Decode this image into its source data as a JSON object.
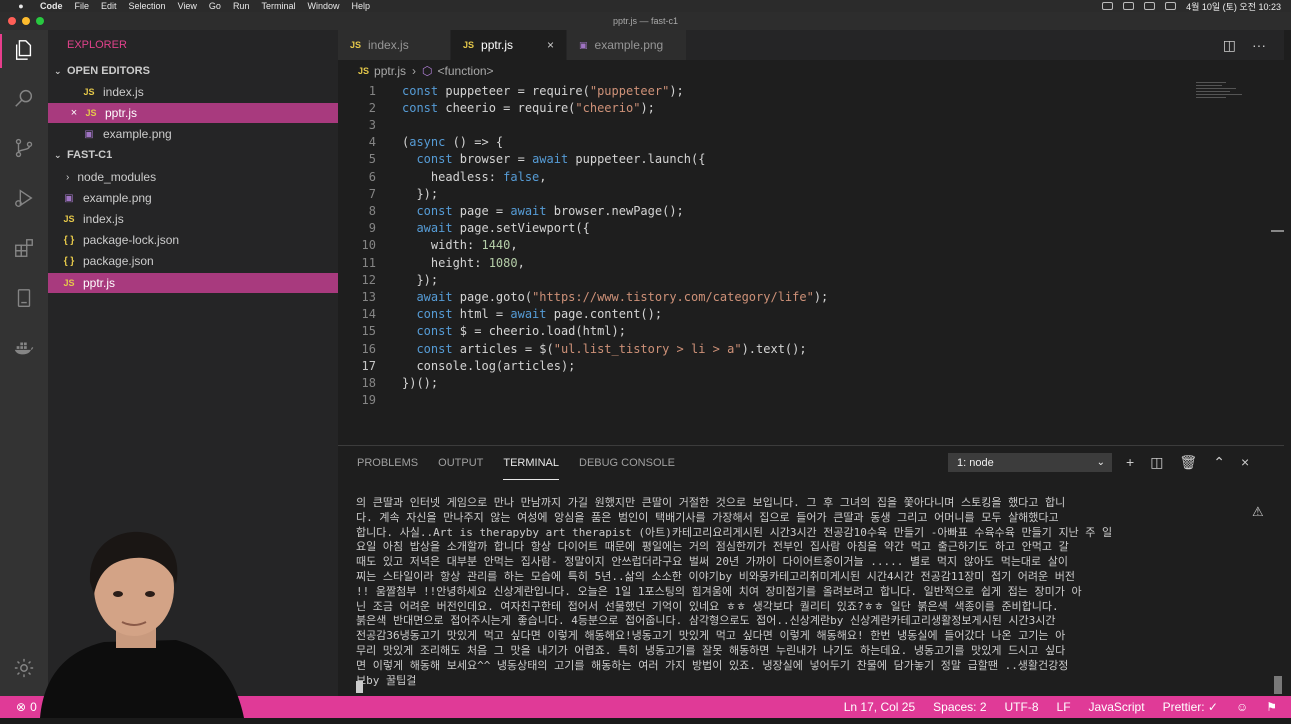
{
  "menubar": {
    "items": [
      "Code",
      "File",
      "Edit",
      "Selection",
      "View",
      "Go",
      "Run",
      "Terminal",
      "Window",
      "Help"
    ],
    "clock": "4월 10일 (토) 오전 10:23"
  },
  "window": {
    "title": "pptr.js — fast-c1"
  },
  "sidebar": {
    "title": "EXPLORER",
    "open_editors_label": "OPEN EDITORS",
    "open_editors": [
      {
        "label": "index.js",
        "type": "js"
      },
      {
        "label": "pptr.js",
        "type": "js",
        "selected": true
      },
      {
        "label": "example.png",
        "type": "img"
      }
    ],
    "folder_label": "FAST-C1",
    "files": [
      {
        "label": "node_modules",
        "type": "folder"
      },
      {
        "label": "example.png",
        "type": "img"
      },
      {
        "label": "index.js",
        "type": "js"
      },
      {
        "label": "package-lock.json",
        "type": "json"
      },
      {
        "label": "package.json",
        "type": "json"
      },
      {
        "label": "pptr.js",
        "type": "js",
        "selected": true
      }
    ]
  },
  "tabs": [
    {
      "label": "index.js",
      "icon": "JS"
    },
    {
      "label": "pptr.js",
      "icon": "JS",
      "active": true
    },
    {
      "label": "example.png",
      "icon": "img"
    }
  ],
  "breadcrumb": {
    "file": "pptr.js",
    "symbol": "<function>"
  },
  "editor": {
    "lines": [
      "const puppeteer = require(\"puppeteer\");",
      "const cheerio = require(\"cheerio\");",
      "",
      "(async () => {",
      "  const browser = await puppeteer.launch({",
      "    headless: false,",
      "  });",
      "  const page = await browser.newPage();",
      "  await page.setViewport({",
      "    width: 1440,",
      "    height: 1080,",
      "  });",
      "  await page.goto(\"https://www.tistory.com/category/life\");",
      "  const html = await page.content();",
      "  const $ = cheerio.load(html);",
      "  const articles = $(\"ul.list_tistory > li > a\").text();",
      "  console.log(articles);",
      "})();",
      ""
    ],
    "line_numbers": [
      "1",
      "2",
      "3",
      "4",
      "5",
      "6",
      "7",
      "8",
      "9",
      "10",
      "11",
      "12",
      "13",
      "14",
      "15",
      "16",
      "17",
      "18",
      "19"
    ]
  },
  "panel": {
    "tabs": [
      "PROBLEMS",
      "OUTPUT",
      "TERMINAL",
      "DEBUG CONSOLE"
    ],
    "active_tab": "TERMINAL",
    "terminal_select": "1: node",
    "output_lines": [
      "의 큰딸과 인터넷 게임으로 만나 만남까지 가길 원했지만 큰딸이 거절한 것으로 보입니다. 그 후 그녀의 집을 쫓아다니며 스토킹을 했다고 합니",
      "다. 계속 자신을 만나주지 않는 여성에 앙심을 품은 범인이 택배기사를 가장해서 집으로 들어가 큰딸과 동생 그리고 어머니를 모두 살해했다고",
      "합니다. 사실..Art is therapyby art therapist (아트)카테고리요리게시된 시간3시간 전공감10수육 만들기 -아빠표 수육수육 만들기 지난 주 일",
      "요일 아침 밥상을 소개할까 합니다 항상 다이어트 때문에 평일에는 거의 점심한끼가 전부인 집사람 아침을 약간 먹고 출근하기도 하고 안먹고 갈",
      "때도 있고 저녁은 대부분 안먹는 집사람- 정말이지 안쓰럽더라구요 벌써 20년 가까이 다이어트중이거늘 ..... 별로 먹지 않아도 먹는대로 살이",
      "찌는 스타일이라 항상 관리를 하는 모습에 특히 5년..삶의 소소한 이야기by 비와몽카테고리취미게시된 시간4시간 전공감11장미 접기 어려운 버전",
      "!! 움짤첨부 !!안녕하세요 신상계란입니다. 오늘은 1일 1포스팅의 힘겨움에 치여 장미접기를 올려보려고 합니다. 일반적으로 쉽게 접는 장미가 아",
      "닌 조금 어려운 버전인데요. 여자친구한테 접어서 선물했던 기억이 있네요 ㅎㅎ 생각보다 퀄리티 있죠?ㅎㅎ 일단 붉은색 색종이를 준비합니다.",
      "붉은색 반대면으로 접어주시는게 좋습니다. 4등분으로 접어줍니다. 삼각형으로도 접어..신상계란by 신상계란카테고리생활정보게시된 시간3시간",
      "전공감36냉동고기 맛있게 먹고 싶다면 이렇게 해동해요!냉동고기 맛있게 먹고 싶다면 이렇게 해동해요! 한번 냉동실에 들어갔다 나온 고기는 아",
      "무리 맛있게 조리해도 처음 그 맛을 내기가 어렵죠. 특히 냉동고기를 잘못 해동하면 누린내가 나기도 하는데요. 냉동고기를 맛있게 드시고 싶다",
      "면 이렇게 해동해 보세요^^ 냉동상태의 고기를 해동하는 여러 가지 방법이 있죠. 냉장실에 넣어두기 찬물에 담가놓기 정말 급할땐 ..생활건강정",
      "보by 꿀팁걸"
    ]
  },
  "statusbar": {
    "errors": "0",
    "position": "Ln 17, Col 25",
    "spaces": "Spaces: 2",
    "encoding": "UTF-8",
    "eol": "LF",
    "language": "JavaScript",
    "formatter": "Prettier: ✓"
  },
  "colors": {
    "accent": "#e03a97",
    "selection": "#a83a7e",
    "keyword": "#569cd6",
    "string": "#ce9178",
    "function": "#dcdcaa",
    "variable": "#9cdcfe",
    "number": "#b5cea8"
  }
}
